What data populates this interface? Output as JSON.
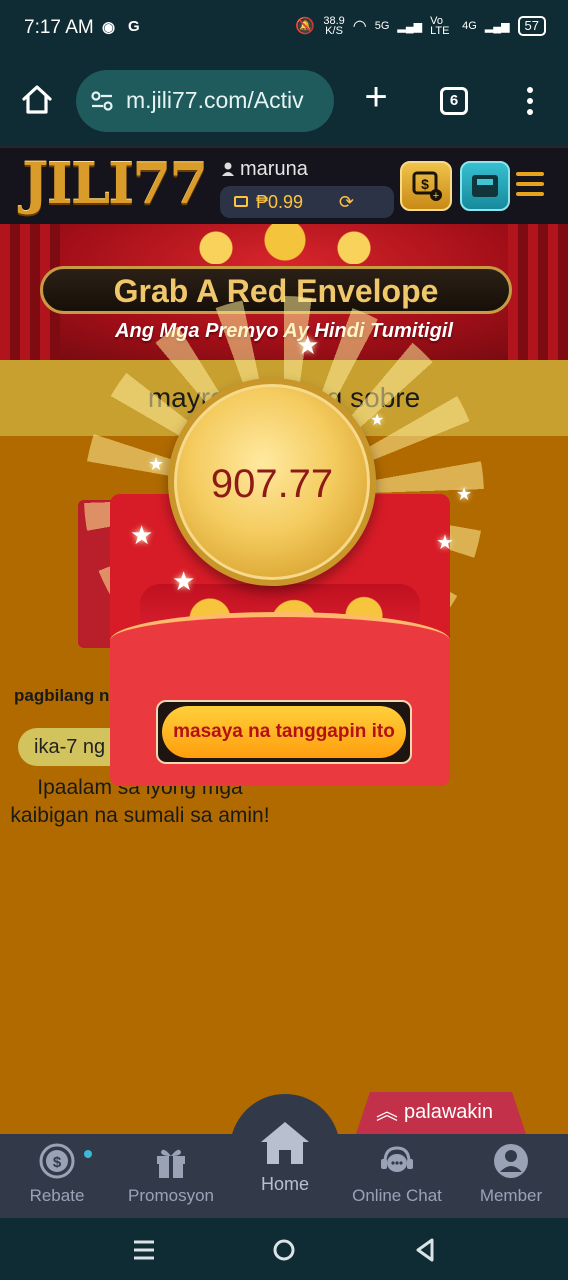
{
  "status_bar": {
    "time": "7:17 AM",
    "net_speed": "38.9",
    "net_speed_unit": "K/S",
    "net1": "5G",
    "volte": "Vo LTE",
    "net2": "4G",
    "battery": "57"
  },
  "browser": {
    "url": "m.jili77.com/Activ",
    "tab_count": "6"
  },
  "site_header": {
    "logo": "JILI77",
    "username": "maruna",
    "balance": "₱0.99"
  },
  "banner": {
    "title": "Grab A Red Envelope",
    "subtitle": "Ang Mga Premyo Ay Hindi Tumitigil"
  },
  "main": {
    "strip_text": "mayroon ... ang sobre",
    "count_label": "pagbilang n",
    "day_label": "ika-7 ng",
    "info_text": "Ipaalam sa iyong mga kaibigan na sumali sa amin!"
  },
  "popup": {
    "amount": "907.77",
    "accept_label": "masaya na tanggapin ito"
  },
  "expand": {
    "label": "palawakin"
  },
  "bottom_nav": {
    "items": [
      {
        "label": "Rebate"
      },
      {
        "label": "Promosyon"
      },
      {
        "label": "Home"
      },
      {
        "label": "Online Chat"
      },
      {
        "label": "Member"
      }
    ]
  },
  "colors": {
    "page_bg": "#b06a00",
    "accent_gold": "#f0c76a",
    "envelope_red": "#d71c27",
    "nav_bg": "#323a4a"
  }
}
